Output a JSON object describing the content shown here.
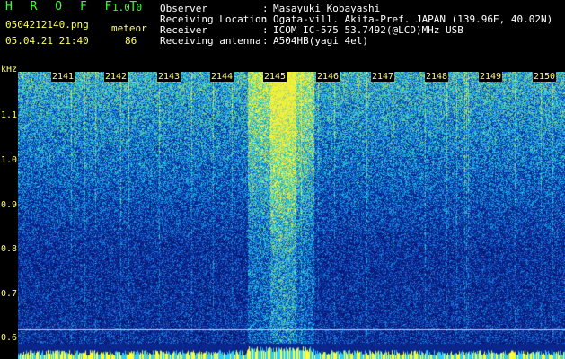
{
  "header": {
    "app_title": "H R O F F T",
    "app_version": "1.0.0",
    "file_name": "0504212140.png",
    "mode_label": "meteor",
    "date_time": "05.04.21 21:40",
    "count": "86",
    "info": [
      {
        "label": "Observer",
        "value": "Masayuki Kobayashi"
      },
      {
        "label": "Receiving Location",
        "value": "Ogata-vill. Akita-Pref. JAPAN (139.96E, 40.02N)"
      },
      {
        "label": "Receiver",
        "value": "ICOM IC-575 53.7492(@LCD)MHz USB"
      },
      {
        "label": "Receiving antenna",
        "value": "A504HB(yagi 4el)"
      }
    ],
    "colon": ":"
  },
  "axis": {
    "unit": "kHz",
    "freq_ticks": [
      "1.1",
      "1.0",
      "0.9",
      "0.8",
      "0.7",
      "0.6"
    ],
    "time_ticks": [
      "2141",
      "2142",
      "2143",
      "2144",
      "2145",
      "2146",
      "2147",
      "2148",
      "2149",
      "2150"
    ]
  },
  "colors": {
    "title": "#39ff39",
    "labels": "#ffff66",
    "background": "#000000",
    "waterfall_low": "#0a1a7a",
    "waterfall_mid": "#1a7aff",
    "waterfall_high": "#ffff33"
  }
}
